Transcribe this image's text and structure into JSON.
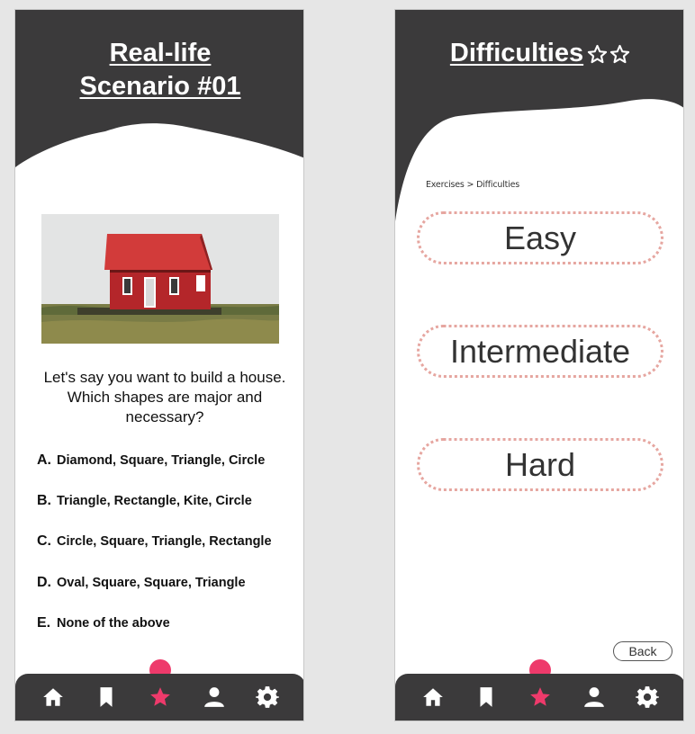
{
  "scenario": {
    "title_line1": "Real-life",
    "title_line2": "Scenario #01",
    "question": "Let's say you want to build a house. Which shapes are major and necessary?",
    "answers": [
      {
        "letter": "A.",
        "text": "Diamond, Square, Triangle, Circle"
      },
      {
        "letter": "B.",
        "text": "Triangle, Rectangle, Kite, Circle"
      },
      {
        "letter": "C.",
        "text": "Circle, Square, Triangle, Rectangle"
      },
      {
        "letter": "D.",
        "text": "Oval, Square, Square, Triangle"
      },
      {
        "letter": "E.",
        "text": "None of the above"
      }
    ]
  },
  "difficulties": {
    "title": "Difficulties",
    "breadcrumb": "Exercises > Difficulties",
    "options": [
      "Easy",
      "Intermediate",
      "Hard"
    ],
    "back_label": "Back"
  },
  "nav": {
    "items": [
      "home-icon",
      "bookmark-icon",
      "star-icon",
      "user-icon",
      "gear-icon"
    ],
    "active_item": "star-icon"
  },
  "colors": {
    "header": "#3b3a3b",
    "accent": "#ee3a6b",
    "button_border": "#e6a6a0",
    "background": "#e6e6e6"
  }
}
